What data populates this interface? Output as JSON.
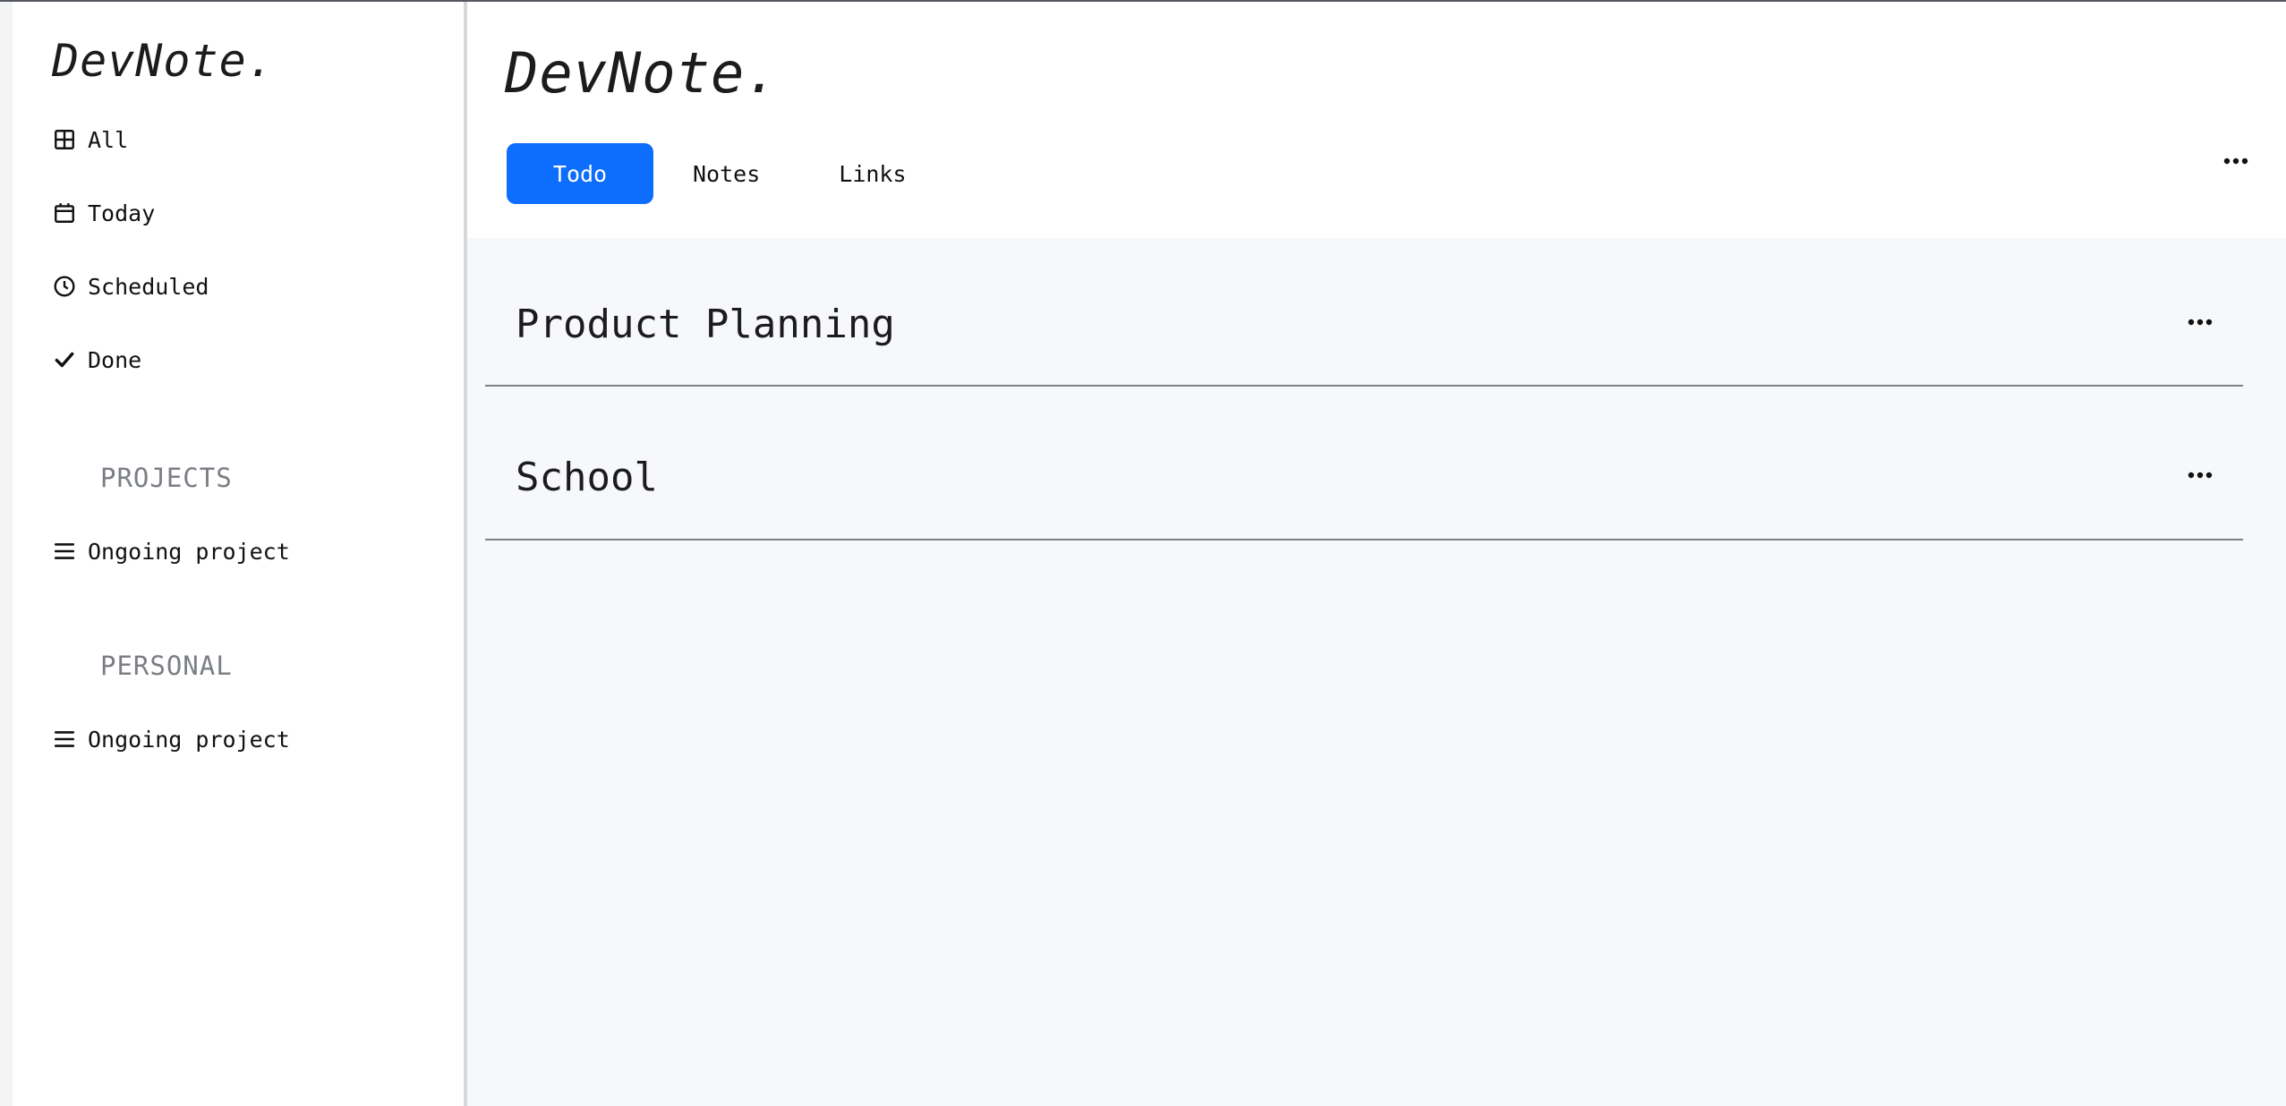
{
  "app": {
    "logo": "DevNote."
  },
  "sidebar": {
    "logo": "DevNote.",
    "nav": [
      {
        "label": "All",
        "icon": "grid-icon"
      },
      {
        "label": "Today",
        "icon": "calendar-icon"
      },
      {
        "label": "Scheduled",
        "icon": "clock-icon"
      },
      {
        "label": "Done",
        "icon": "check-icon"
      }
    ],
    "sections": [
      {
        "title": "PROJECTS",
        "items": [
          {
            "label": "Ongoing project",
            "icon": "list-icon"
          }
        ]
      },
      {
        "title": "PERSONAL",
        "items": [
          {
            "label": "Ongoing project",
            "icon": "list-icon"
          }
        ]
      }
    ]
  },
  "header": {
    "logo": "DevNote.",
    "tabs": [
      {
        "label": "Todo",
        "active": true
      },
      {
        "label": "Notes",
        "active": false
      },
      {
        "label": "Links",
        "active": false
      }
    ],
    "more_icon": "ellipsis-icon"
  },
  "main": {
    "projects": [
      {
        "title": "Product Planning"
      },
      {
        "title": "School"
      }
    ]
  },
  "colors": {
    "accent": "#0d6efd",
    "main_background": "#f7f8fa",
    "section_title": "#7b7f85",
    "divider": "#7d8085"
  }
}
